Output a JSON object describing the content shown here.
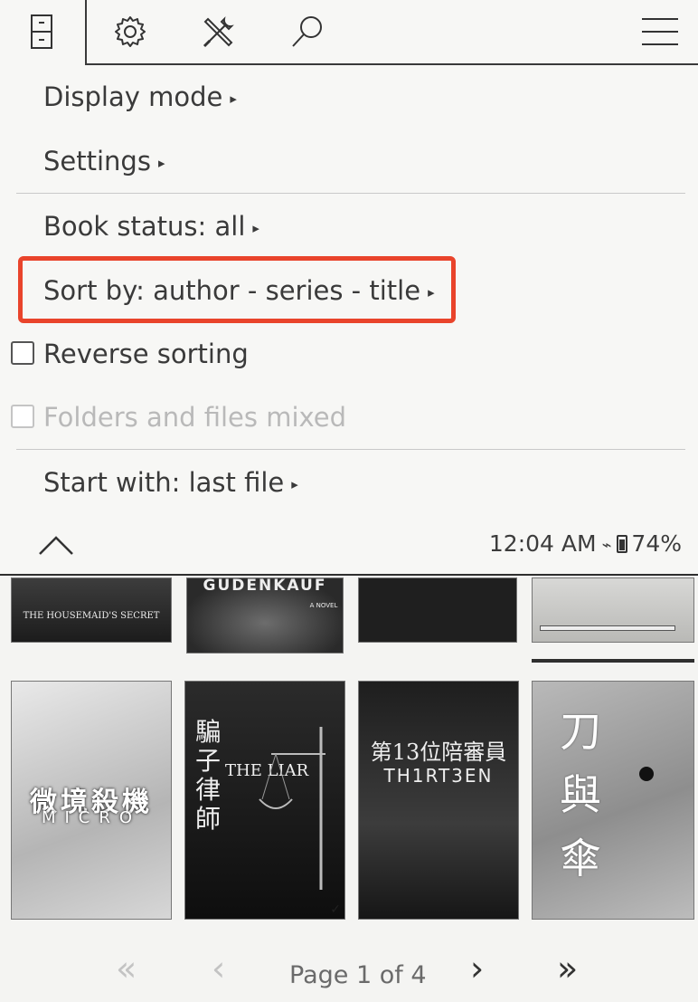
{
  "toolbar": {
    "icons": [
      "library-icon",
      "gear-icon",
      "tools-icon",
      "search-icon",
      "hamburger-menu-icon"
    ]
  },
  "menu": {
    "display_mode": "Display mode",
    "settings": "Settings",
    "book_status": "Book status: all",
    "sort_by": "Sort by: author - series - title",
    "reverse_sorting": "Reverse sorting",
    "folders_files_mixed": "Folders and files mixed",
    "start_with": "Start with: last file",
    "reverse_checked": false,
    "folders_mixed_checked": false,
    "folders_mixed_enabled": false,
    "highlight_color": "#e9442b"
  },
  "status": {
    "time": "12:04 AM",
    "battery": "74%"
  },
  "books": {
    "row1": [
      {
        "title": "THE HOUSEMAID'S SECRET"
      },
      {
        "title": "GUDENKAUF",
        "subtitle": "A NOVEL"
      },
      {
        "title": ""
      },
      {
        "title": ""
      }
    ],
    "row2": [
      {
        "title": "微境殺機",
        "subtitle": "MICRO"
      },
      {
        "title": "騙子律師",
        "subtitle": "THE LIAR"
      },
      {
        "title": "第13位陪審員",
        "subtitle": "TH1RT3EN"
      },
      {
        "title": "刀與傘"
      }
    ]
  },
  "pager": {
    "label": "Page 1 of 4",
    "first": "«",
    "prev": "‹",
    "next": "›",
    "last": "»"
  }
}
